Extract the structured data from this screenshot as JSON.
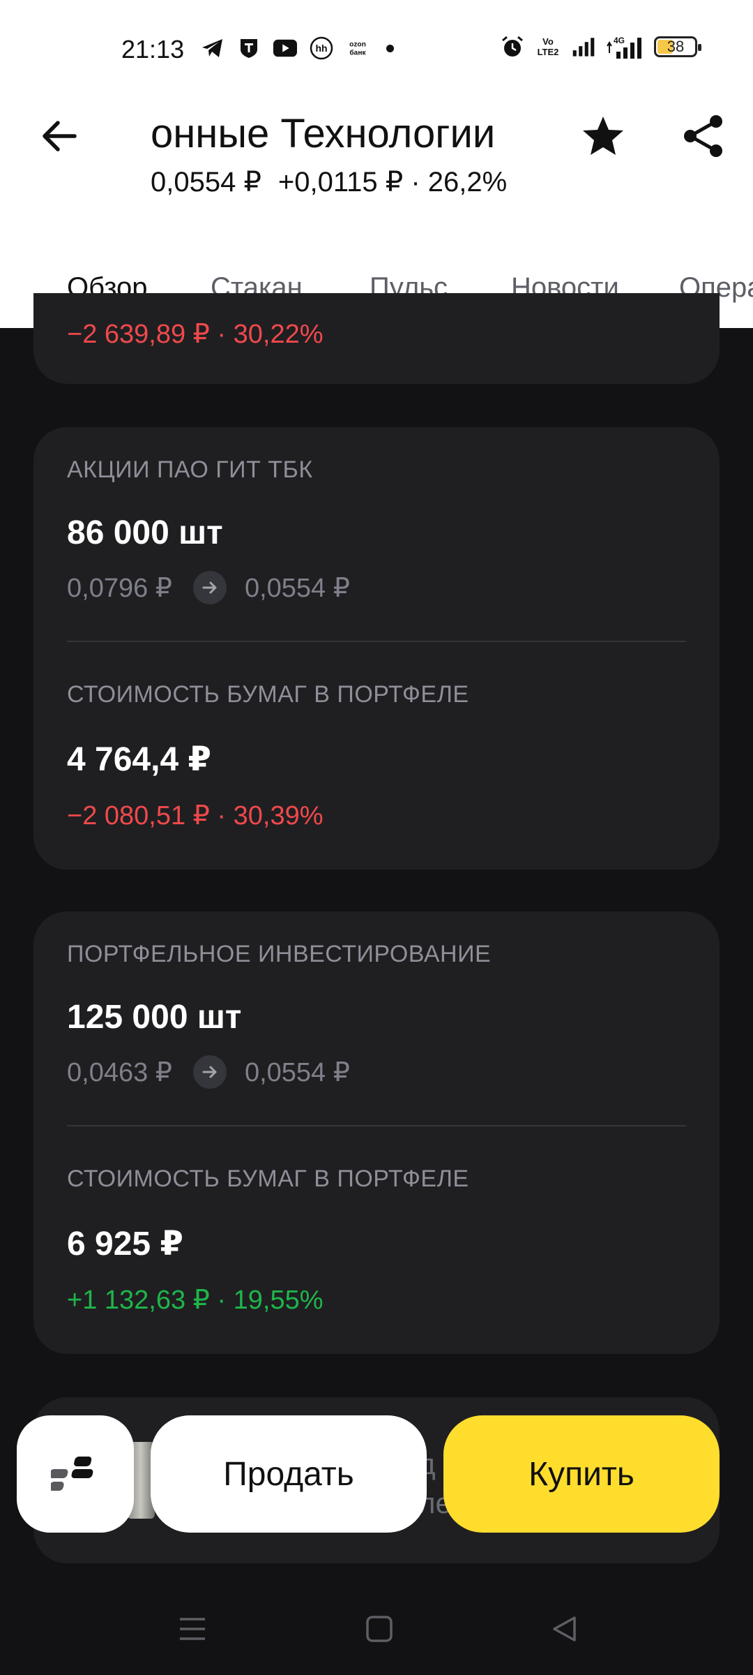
{
  "status": {
    "time": "21:13",
    "battery": "38",
    "ozon_line1": "ozon",
    "ozon_line2": "банк",
    "volte_line1": "Vo LTE",
    "volte_line2": "LTE2",
    "net": "4G"
  },
  "header": {
    "title": "онные Технологии",
    "price": "0,0554 ₽",
    "change": "+0,0115 ₽ · 26,2%"
  },
  "tabs": [
    "Обзор",
    "Стакан",
    "Пульс",
    "Новости",
    "Опера"
  ],
  "top_card": {
    "delta": "−2 639,89 ₽ · 30,22%"
  },
  "cards": [
    {
      "title": "АКЦИИ ПАО ГИТ ТБК",
      "quantity": "86 000 шт",
      "buy_price": "0,0796 ₽",
      "current_price": "0,0554 ₽",
      "value_label": "СТОИМОСТЬ БУМАГ В ПОРТФЕЛЕ",
      "value": "4 764,4 ₽",
      "delta": "−2 080,51 ₽ · 30,39%"
    },
    {
      "title": "ПОРТФЕЛЬНОЕ ИНВЕСТИРОВАНИЕ",
      "quantity": "125 000 шт",
      "buy_price": "0,0463 ₽",
      "current_price": "0,0554 ₽",
      "value_label": "СТОИМОСТЬ БУМАГ В ПОРТФЕЛЕ",
      "value": "6 925 ₽",
      "delta": "+1 132,63 ₽ · 19,55%"
    }
  ],
  "peek": {
    "line1": "д",
    "line2": "ле"
  },
  "actions": {
    "sell": "Продать",
    "buy": "Купить"
  },
  "colors": {
    "negative": "#f0494b",
    "positive": "#1fb64a",
    "buy_button": "#ffdd2d",
    "card_bg": "#1f1f22"
  }
}
